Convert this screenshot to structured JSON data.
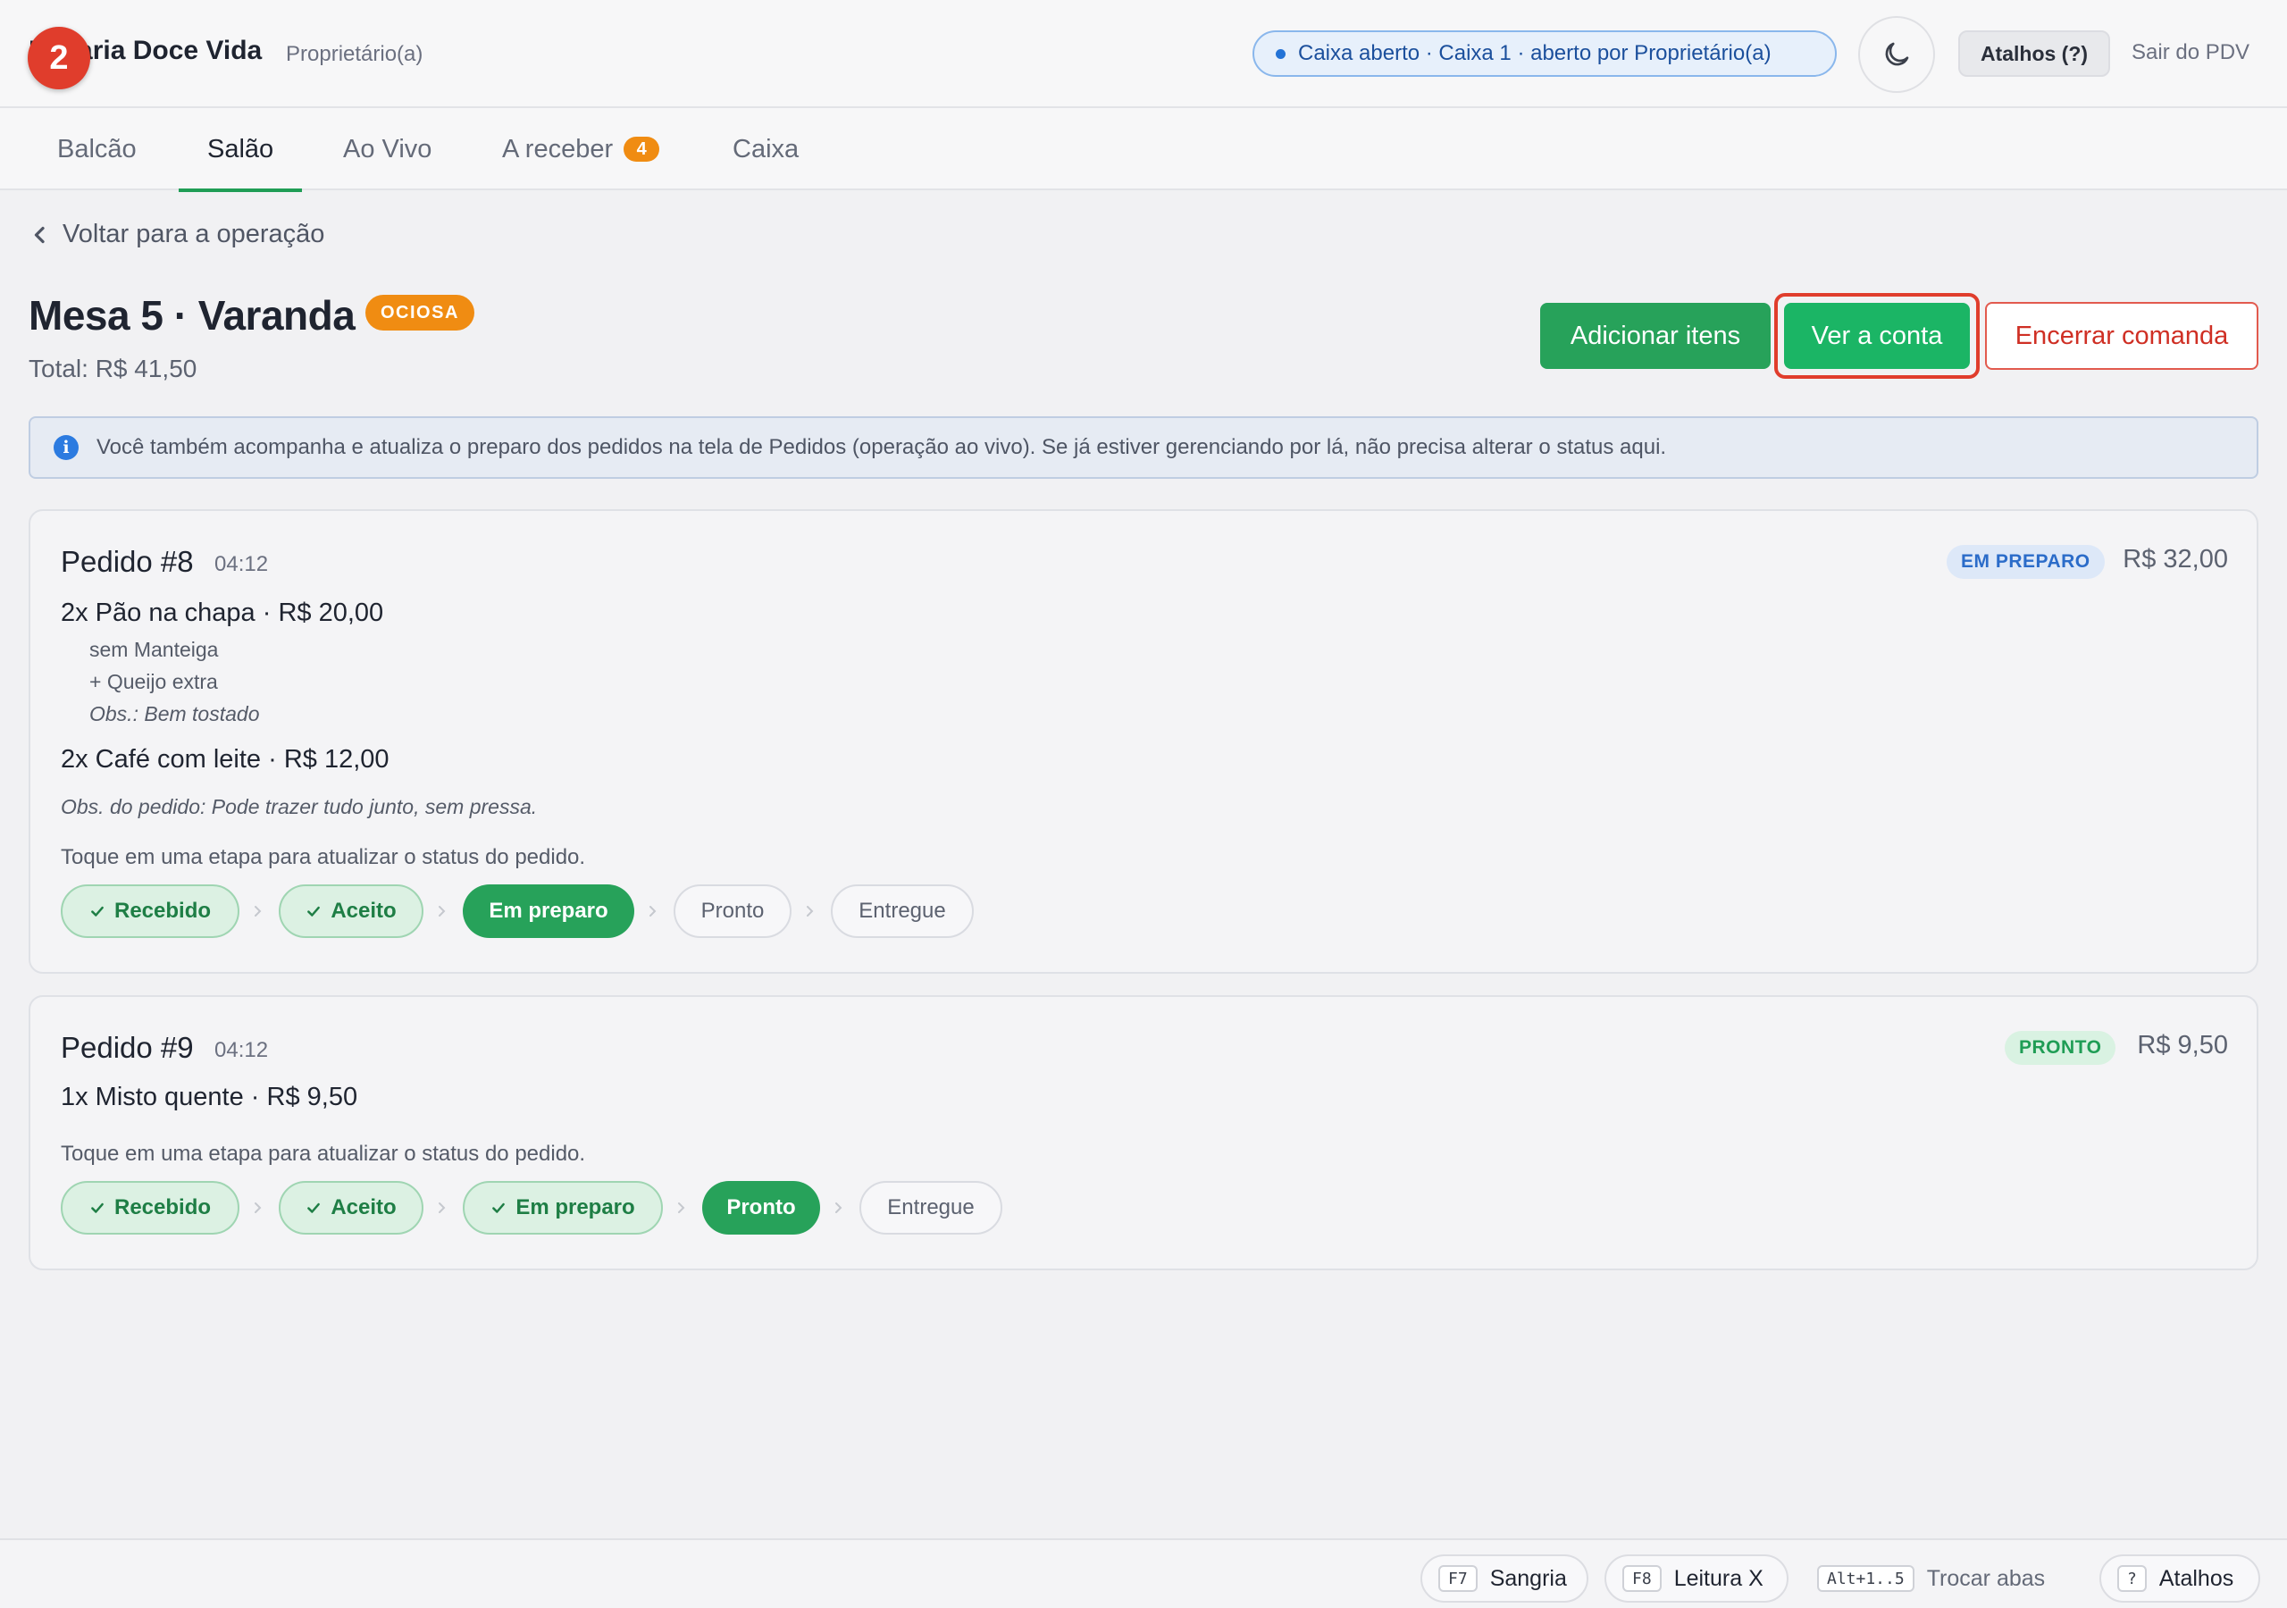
{
  "topbar": {
    "step_badge": "2",
    "store_name": "Padaria Doce Vida",
    "store_role": "Proprietário(a)",
    "cash_status": "Caixa aberto · Caixa 1 · aberto por Proprietário(a)",
    "theme_icon": "moon-icon",
    "shortcuts_label": "Atalhos (?)",
    "logout_label": "Sair do PDV"
  },
  "tabs": [
    {
      "label": "Balcão",
      "active": false
    },
    {
      "label": "Salão",
      "active": true
    },
    {
      "label": "Ao Vivo",
      "active": false
    },
    {
      "label": "A receber",
      "count": "4",
      "active": false
    },
    {
      "label": "Caixa",
      "active": false
    }
  ],
  "header": {
    "back_label": "Voltar para a operação",
    "table_title": "Mesa 5 · Varanda",
    "status_badge": "OCIOSA",
    "total": "Total: R$ 41,50",
    "actions": {
      "add_items": "Adicionar itens",
      "view_bill": "Ver a conta",
      "close_tab": "Encerrar comanda"
    }
  },
  "info_banner": {
    "icon": "i",
    "text": "Você também acompanha e atualiza o preparo dos pedidos na tela de Pedidos (operação ao vivo). Se já estiver gerenciando por lá, não precisa alterar o status aqui."
  },
  "orders": [
    {
      "title": "Pedido #8",
      "time": "04:12",
      "status": "EM PREPARO",
      "amount": "R$ 32,00",
      "items": [
        {
          "line": "2x Pão na chapa · R$ 20,00",
          "mods": [
            "sem Manteiga",
            "+ Queijo extra"
          ],
          "obs": "Obs.: Bem tostado"
        },
        {
          "line": "2x Café com leite · R$ 12,00"
        }
      ],
      "order_note": "Obs. do pedido: Pode trazer tudo junto, sem pressa.",
      "hint": "Toque em uma etapa para atualizar o status do pedido.",
      "steps": [
        {
          "label": "Recebido",
          "state": "done"
        },
        {
          "label": "Aceito",
          "state": "done"
        },
        {
          "label": "Em preparo",
          "state": "current"
        },
        {
          "label": "Pronto",
          "state": "todo"
        },
        {
          "label": "Entregue",
          "state": "todo"
        }
      ]
    },
    {
      "title": "Pedido #9",
      "time": "04:12",
      "status": "PRONTO",
      "amount": "R$ 9,50",
      "items": [
        {
          "line": "1x Misto quente · R$ 9,50"
        }
      ],
      "hint": "Toque em uma etapa para atualizar o status do pedido.",
      "steps": [
        {
          "label": "Recebido",
          "state": "done"
        },
        {
          "label": "Aceito",
          "state": "done"
        },
        {
          "label": "Em preparo",
          "state": "done"
        },
        {
          "label": "Pronto",
          "state": "current"
        },
        {
          "label": "Entregue",
          "state": "todo"
        }
      ]
    }
  ],
  "footer": {
    "sangria": {
      "key": "F7",
      "label": "Sangria"
    },
    "leitura": {
      "key": "F8",
      "label": "Leitura X"
    },
    "tabs_switch": {
      "key": "Alt+1..5",
      "label": "Trocar abas"
    },
    "atalhos": {
      "key": "?",
      "label": "Atalhos"
    }
  },
  "colors": {
    "accent_green": "#27a25a",
    "view_bill_green": "#1bb565",
    "danger_red": "#cf2f24",
    "idle_orange": "#f08c12",
    "info_blue": "#2c7be0",
    "highlight_ring": "#e03d2c"
  }
}
